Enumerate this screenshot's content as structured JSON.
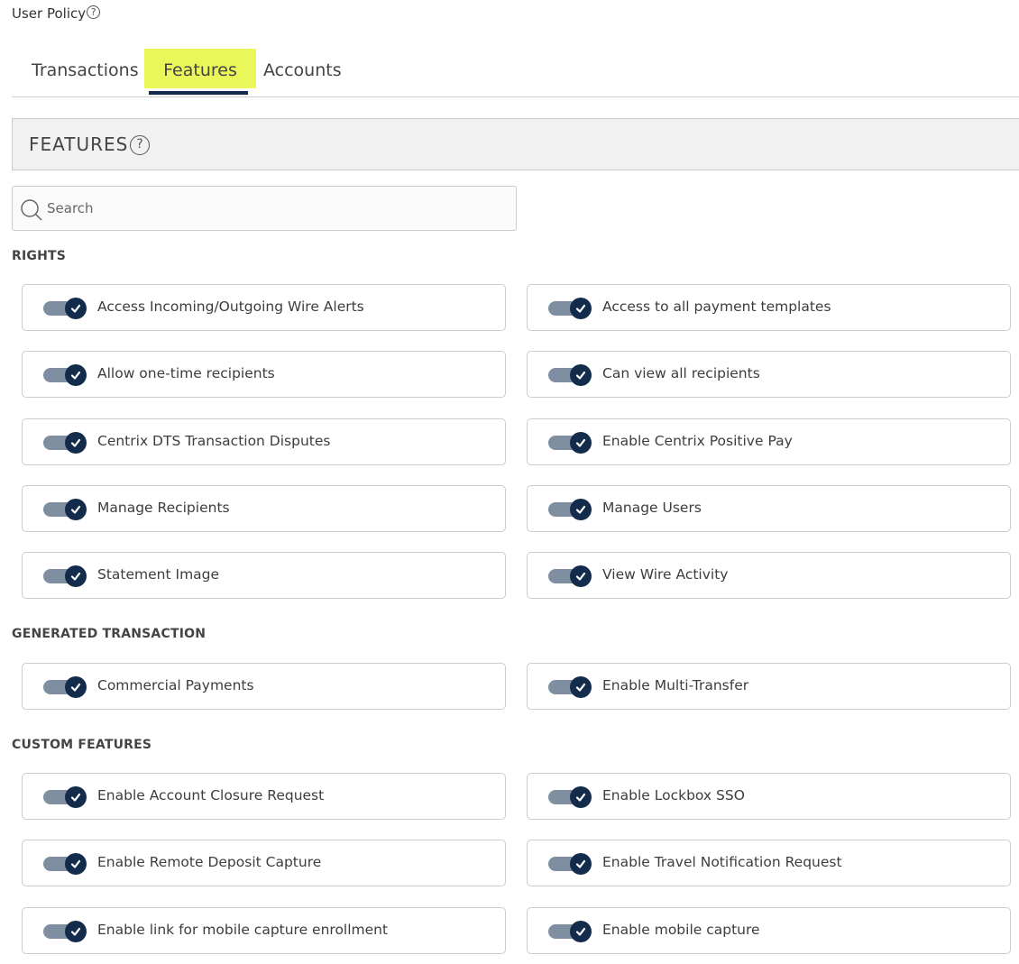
{
  "header": {
    "title": "User Policy",
    "help_icon": "question-circle-icon"
  },
  "tabs": [
    {
      "label": "Transactions",
      "active": false
    },
    {
      "label": "Features",
      "active": true
    },
    {
      "label": "Accounts",
      "active": false
    }
  ],
  "section": {
    "title": "FEATURES",
    "help_icon": "question-circle-icon"
  },
  "search": {
    "placeholder": "Search",
    "value": "",
    "icon": "search-icon"
  },
  "colors": {
    "tab_highlight": "#eaf75a",
    "tab_underline": "#102a4a",
    "toggle_track": "#7f8ea0",
    "toggle_knob": "#142c4c"
  },
  "groups": [
    {
      "label": "RIGHTS",
      "items": [
        {
          "label": "Access Incoming/Outgoing Wire Alerts",
          "enabled": true
        },
        {
          "label": "Access to all payment templates",
          "enabled": true
        },
        {
          "label": "Allow one-time recipients",
          "enabled": true
        },
        {
          "label": "Can view all recipients",
          "enabled": true
        },
        {
          "label": "Centrix DTS Transaction Disputes",
          "enabled": true
        },
        {
          "label": "Enable Centrix Positive Pay",
          "enabled": true
        },
        {
          "label": "Manage Recipients",
          "enabled": true
        },
        {
          "label": "Manage Users",
          "enabled": true
        },
        {
          "label": "Statement Image",
          "enabled": true
        },
        {
          "label": "View Wire Activity",
          "enabled": true
        }
      ]
    },
    {
      "label": "GENERATED TRANSACTION",
      "items": [
        {
          "label": "Commercial Payments",
          "enabled": true
        },
        {
          "label": "Enable Multi-Transfer",
          "enabled": true
        }
      ]
    },
    {
      "label": "CUSTOM FEATURES",
      "items": [
        {
          "label": "Enable Account Closure Request",
          "enabled": true
        },
        {
          "label": "Enable Lockbox SSO",
          "enabled": true
        },
        {
          "label": "Enable Remote Deposit Capture",
          "enabled": true
        },
        {
          "label": "Enable Travel Notification Request",
          "enabled": true
        },
        {
          "label": "Enable link for mobile capture enrollment",
          "enabled": true
        },
        {
          "label": "Enable mobile capture",
          "enabled": true
        }
      ]
    }
  ]
}
